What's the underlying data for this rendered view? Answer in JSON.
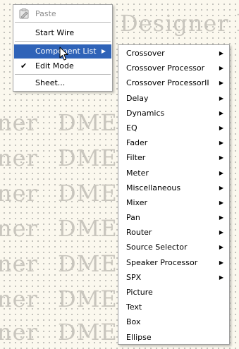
{
  "watermark": {
    "top_text": "Designer  l",
    "left_text": "ner",
    "mid_text": "DME"
  },
  "context_menu": {
    "items": [
      {
        "label": "Paste",
        "disabled": true,
        "icon": "paste-icon"
      },
      {
        "label": "Start Wire"
      },
      {
        "label": "Component List",
        "highlighted": true,
        "submenu": true
      },
      {
        "label": "Edit Mode",
        "checked": true
      },
      {
        "label": "Sheet..."
      }
    ]
  },
  "submenu": {
    "items": [
      {
        "label": "Crossover",
        "submenu": true
      },
      {
        "label": "Crossover Processor",
        "submenu": true
      },
      {
        "label": "Crossover ProcessorII",
        "submenu": true
      },
      {
        "label": "Delay",
        "submenu": true
      },
      {
        "label": "Dynamics",
        "submenu": true
      },
      {
        "label": "EQ",
        "submenu": true
      },
      {
        "label": "Fader",
        "submenu": true
      },
      {
        "label": "Filter",
        "submenu": true
      },
      {
        "label": "Meter",
        "submenu": true
      },
      {
        "label": "Miscellaneous",
        "submenu": true
      },
      {
        "label": "Mixer",
        "submenu": true
      },
      {
        "label": "Pan",
        "submenu": true
      },
      {
        "label": "Router",
        "submenu": true
      },
      {
        "label": "Source Selector",
        "submenu": true
      },
      {
        "label": "Speaker Processor",
        "submenu": true
      },
      {
        "label": "SPX",
        "submenu": true
      },
      {
        "label": "Picture",
        "submenu": false
      },
      {
        "label": "Text",
        "submenu": false
      },
      {
        "label": "Box",
        "submenu": false
      },
      {
        "label": "Ellipse",
        "submenu": false
      }
    ]
  },
  "glyphs": {
    "arrow": "▶",
    "check": "✔"
  },
  "colors": {
    "highlight": "#2f63b8",
    "canvas": "#fbf8ee",
    "disabled_text": "#8c8c8c"
  }
}
